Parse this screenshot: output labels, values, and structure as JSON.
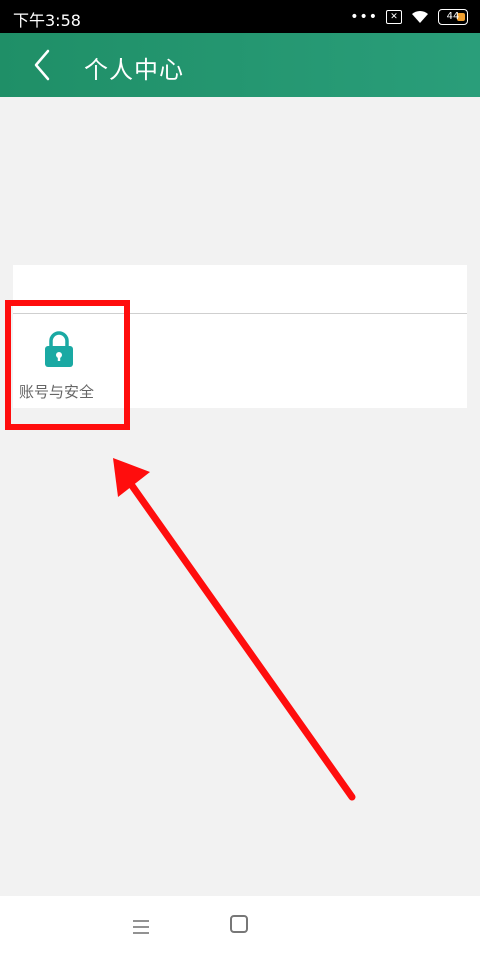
{
  "status_bar": {
    "time": "下午3:58",
    "dots": "•••",
    "sim": "✕",
    "battery": "44"
  },
  "header": {
    "title": "个人中心",
    "color": "#23956f"
  },
  "menu": {
    "items": [
      {
        "label": "账号与安全",
        "icon": "lock-icon",
        "icon_color": "#1aa9a3"
      }
    ]
  },
  "annotation": {
    "highlight_color": "#ff0d0d"
  }
}
